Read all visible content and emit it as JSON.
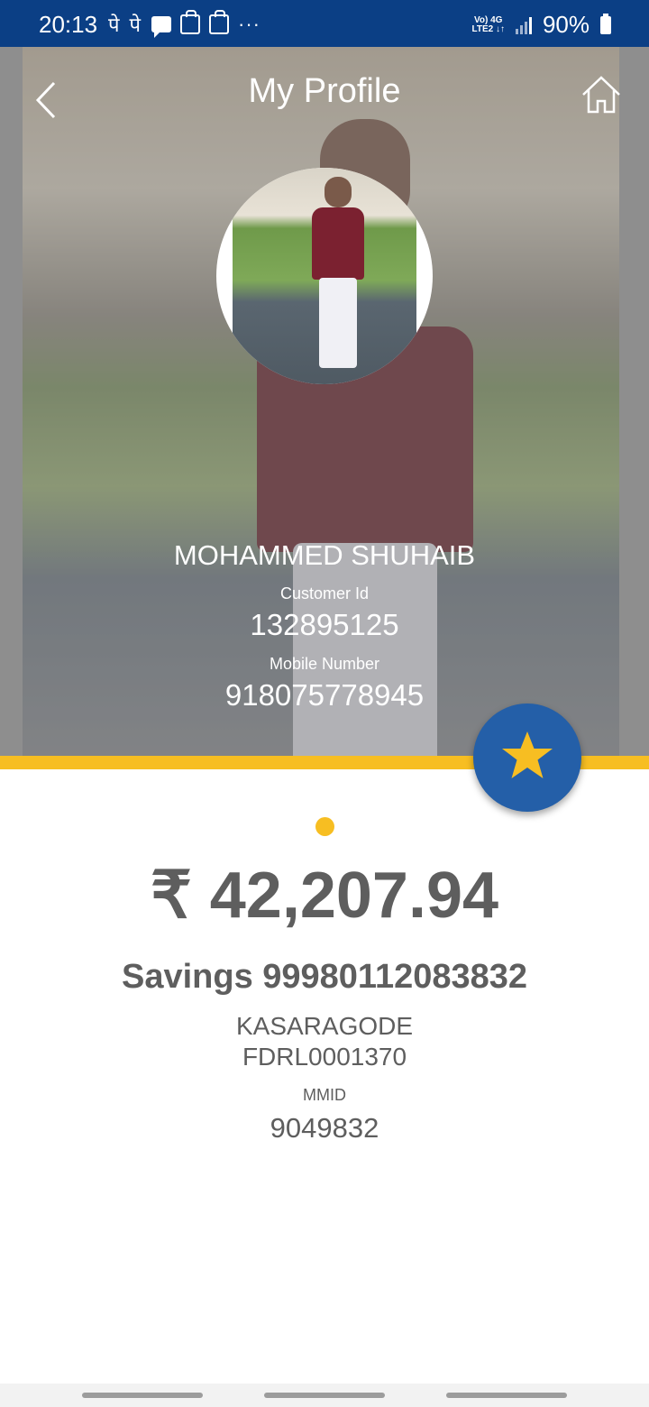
{
  "status_bar": {
    "time": "20:13",
    "left_glyphs": "पे पे",
    "more": "···",
    "network_top": "Vo) 4G",
    "network_bottom": "LTE2 ↓↑",
    "battery": "90%",
    "icons": [
      "message-icon",
      "bag-icon",
      "bag-icon",
      "signal-icon",
      "battery-icon"
    ]
  },
  "header": {
    "title": "My Profile",
    "back_icon": "chevron-left-icon",
    "home_icon": "home-icon"
  },
  "profile": {
    "name": "MOHAMMED SHUHAIB",
    "customer_id_label": "Customer Id",
    "customer_id": "132895125",
    "mobile_label": "Mobile Number",
    "mobile": "918075778945"
  },
  "favorite": {
    "icon": "star-icon"
  },
  "account": {
    "balance": "₹ 42,207.94",
    "title": "Savings 99980112083832",
    "branch": "KASARAGODE",
    "ifsc": "FDRL0001370",
    "mmid_label": "MMID",
    "mmid": "9049832"
  },
  "colors": {
    "status_bar": "#0b3f85",
    "accent": "#f7be22",
    "fab": "#245fa8",
    "text_gray": "#5e5e5e"
  }
}
